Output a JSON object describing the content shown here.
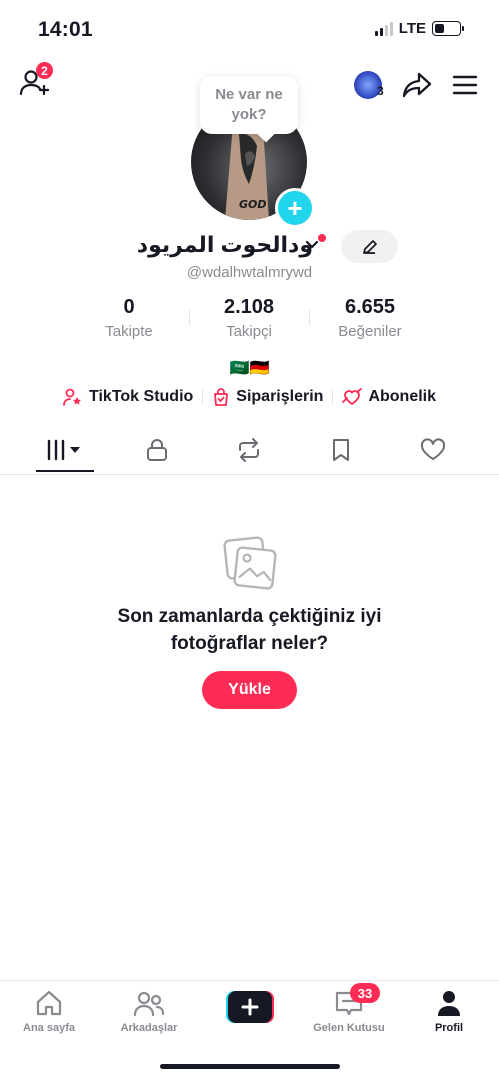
{
  "status": {
    "time": "14:01",
    "network": "LTE"
  },
  "header": {
    "add_friend_badge": "2",
    "account_badge": "3"
  },
  "tooltip": {
    "line1": "Ne var ne",
    "line2": "yok?"
  },
  "profile": {
    "name": "ودالحوت المريود",
    "username": "@wdalhwtalmrywd",
    "flags": "🇸🇦🇩🇪"
  },
  "stats": [
    {
      "value": "0",
      "label": "Takipte"
    },
    {
      "value": "2.108",
      "label": "Takipçi"
    },
    {
      "value": "6.655",
      "label": "Beğeniler"
    }
  ],
  "links": [
    {
      "label": "TikTok Studio"
    },
    {
      "label": "Siparişlerin"
    },
    {
      "label": "Abonelik"
    }
  ],
  "empty": {
    "line1": "Son zamanlarda çektiğiniz iyi",
    "line2": "fotoğraflar neler?",
    "button": "Yükle"
  },
  "nav": [
    {
      "label": "Ana sayfa"
    },
    {
      "label": "Arkadaşlar"
    },
    {
      "label": "Gelen Kutusu",
      "badge": "33"
    },
    {
      "label": "Profil"
    }
  ],
  "colors": {
    "accent": "#fe2c55",
    "cyan": "#20d5ec",
    "text": "#161823",
    "muted": "#8a8b91"
  }
}
